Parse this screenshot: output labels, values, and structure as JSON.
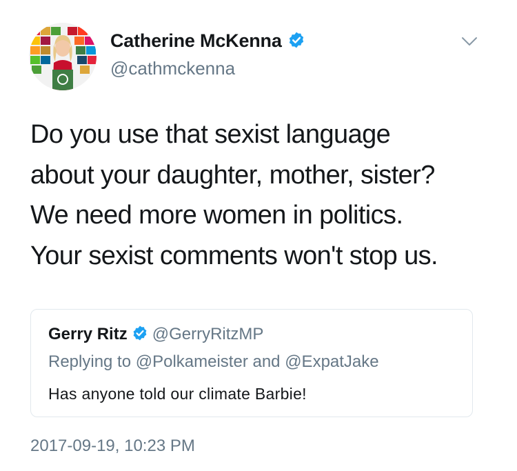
{
  "tweet": {
    "author": {
      "display_name": "Catherine McKenna",
      "handle": "@cathmckenna",
      "verified": true
    },
    "text": "Do you use that sexist language\nabout your daughter, mother, sister?\nWe need more women in politics.\nYour sexist comments won't stop us.",
    "timestamp": "2017-09-19, 10:23 PM"
  },
  "quoted_tweet": {
    "display_name": "Gerry Ritz",
    "handle": "@GerryRitzMP",
    "verified": true,
    "reply_to": "Replying to @Polkameister and @ExpatJake",
    "text": "Has anyone told our climate Barbie!"
  },
  "colors": {
    "text_primary": "#14171a",
    "text_secondary": "#657786",
    "verified_blue": "#1da1f2",
    "border": "#e1e8ed"
  },
  "icons": {
    "verified": "verified-badge-icon",
    "menu": "chevron-down-icon"
  }
}
